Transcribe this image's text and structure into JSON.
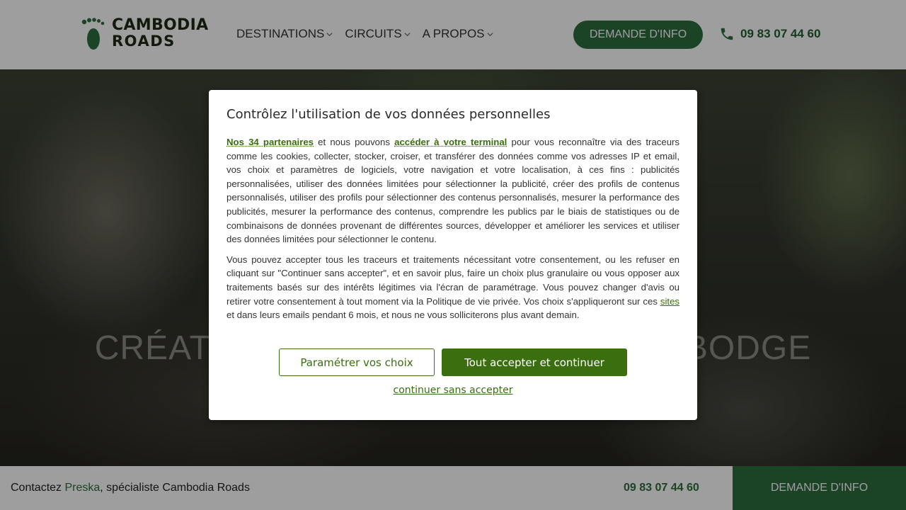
{
  "header": {
    "logo_line1": "CAMBODIA",
    "logo_line2": "ROADS",
    "nav": [
      {
        "label": "DESTINATIONS"
      },
      {
        "label": "CIRCUITS"
      },
      {
        "label": "A PROPOS"
      }
    ],
    "cta_label": "DEMANDE D'INFO",
    "phone": "09 83 07 44 60"
  },
  "hero": {
    "title_left": "CRÉAT",
    "title_right": "BODGE"
  },
  "consent": {
    "title": "Contrôlez l'utilisation de vos données personnelles",
    "partners_link": "Nos 34 partenaires",
    "p1_mid": " et nous pouvons ",
    "terminal_link": "accéder à votre terminal",
    "p1_rest": " pour vous reconnaître via des traceurs comme les cookies, collecter, stocker, croiser, et transférer des données comme vos adresses IP et email, vos choix et paramètres de logiciels, votre navigation et votre localisation, à ces fins : publicités personnalisées, utiliser des données limitées pour sélectionner la publicité, créer des profils de contenus personnalisés, utiliser des profils pour sélectionner des contenus personnalisés, mesurer la performance des publicités, mesurer la performance des contenus, comprendre les publics par le biais de statistiques ou de combinaisons de données provenant de différentes sources, développer et améliorer les services et utiliser des données limitées pour sélectionner le contenu.",
    "p2_start": "Vous pouvez accepter tous les traceurs et traitements nécessitant votre consentement, ou les refuser en cliquant sur \"Continuer sans accepter\", et en savoir plus, faire un choix plus granulaire ou vous opposer aux traitements basés sur des intérêts légitimes via l'écran de paramétrage. Vous pouvez changer d'avis ou retirer votre consentement à tout moment via la Politique de vie privée. Vos choix s'appliqueront sur ces ",
    "sites_link": "sites",
    "p2_end": " et dans leurs emails pendant 6 mois, et nous ne vous solliciterons plus avant demain.",
    "btn_settings": "Paramétrer vos choix",
    "btn_accept": "Tout accepter et continuer",
    "continue_link": "continuer sans accepter"
  },
  "footer_bar": {
    "contact_prefix": "Contactez ",
    "contact_name": "Preska",
    "contact_suffix": ", spécialiste Cambodia Roads",
    "phone": "09 83 07 44 60",
    "cta_label": "DEMANDE D'INFO"
  },
  "colors": {
    "brand_green": "#2c6e3f",
    "consent_green": "#3a6e0f"
  }
}
